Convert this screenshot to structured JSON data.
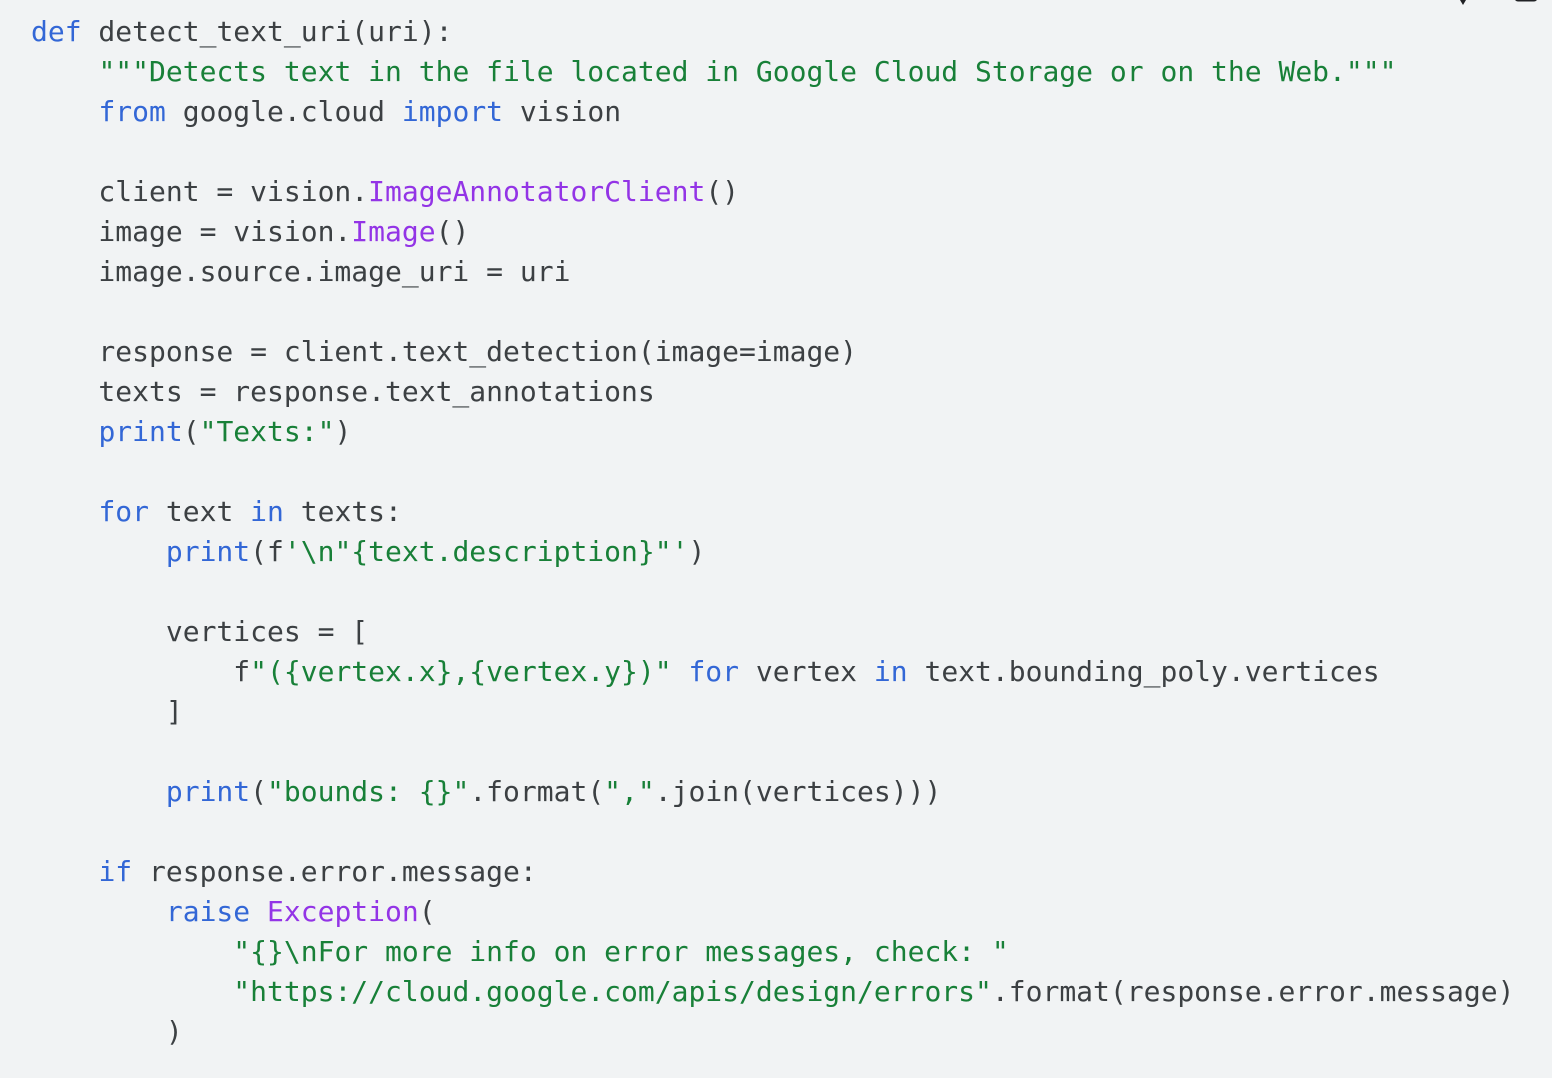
{
  "toolbar": {
    "icons": [
      "feedback-icon",
      "copy-icon"
    ]
  },
  "code": {
    "language": "python",
    "lines": [
      [
        {
          "t": "keyword",
          "v": "def"
        },
        {
          "t": "plain",
          "v": " detect_text_uri(uri):"
        }
      ],
      [
        {
          "t": "plain",
          "v": "    "
        },
        {
          "t": "string",
          "v": "\"\"\"Detects text in the file located in Google Cloud Storage or on the Web.\"\"\""
        }
      ],
      [
        {
          "t": "plain",
          "v": "    "
        },
        {
          "t": "keyword",
          "v": "from"
        },
        {
          "t": "plain",
          "v": " google.cloud "
        },
        {
          "t": "keyword",
          "v": "import"
        },
        {
          "t": "plain",
          "v": " vision"
        }
      ],
      [
        {
          "t": "plain",
          "v": ""
        }
      ],
      [
        {
          "t": "plain",
          "v": "    client = vision."
        },
        {
          "t": "class",
          "v": "ImageAnnotatorClient"
        },
        {
          "t": "plain",
          "v": "()"
        }
      ],
      [
        {
          "t": "plain",
          "v": "    image = vision."
        },
        {
          "t": "class",
          "v": "Image"
        },
        {
          "t": "plain",
          "v": "()"
        }
      ],
      [
        {
          "t": "plain",
          "v": "    image.source.image_uri = uri"
        }
      ],
      [
        {
          "t": "plain",
          "v": ""
        }
      ],
      [
        {
          "t": "plain",
          "v": "    response = client.text_detection(image=image)"
        }
      ],
      [
        {
          "t": "plain",
          "v": "    texts = response.text_annotations"
        }
      ],
      [
        {
          "t": "plain",
          "v": "    "
        },
        {
          "t": "builtin",
          "v": "print"
        },
        {
          "t": "plain",
          "v": "("
        },
        {
          "t": "string",
          "v": "\"Texts:\""
        },
        {
          "t": "plain",
          "v": ")"
        }
      ],
      [
        {
          "t": "plain",
          "v": ""
        }
      ],
      [
        {
          "t": "plain",
          "v": "    "
        },
        {
          "t": "keyword",
          "v": "for"
        },
        {
          "t": "plain",
          "v": " text "
        },
        {
          "t": "keyword",
          "v": "in"
        },
        {
          "t": "plain",
          "v": " texts:"
        }
      ],
      [
        {
          "t": "plain",
          "v": "        "
        },
        {
          "t": "builtin",
          "v": "print"
        },
        {
          "t": "plain",
          "v": "(f"
        },
        {
          "t": "string",
          "v": "'\\n\"{text.description}\"'"
        },
        {
          "t": "plain",
          "v": ")"
        }
      ],
      [
        {
          "t": "plain",
          "v": ""
        }
      ],
      [
        {
          "t": "plain",
          "v": "        vertices = ["
        }
      ],
      [
        {
          "t": "plain",
          "v": "            f"
        },
        {
          "t": "string",
          "v": "\"({vertex.x},{vertex.y})\""
        },
        {
          "t": "plain",
          "v": " "
        },
        {
          "t": "keyword",
          "v": "for"
        },
        {
          "t": "plain",
          "v": " vertex "
        },
        {
          "t": "keyword",
          "v": "in"
        },
        {
          "t": "plain",
          "v": " text.bounding_poly.vertices"
        }
      ],
      [
        {
          "t": "plain",
          "v": "        ]"
        }
      ],
      [
        {
          "t": "plain",
          "v": ""
        }
      ],
      [
        {
          "t": "plain",
          "v": "        "
        },
        {
          "t": "builtin",
          "v": "print"
        },
        {
          "t": "plain",
          "v": "("
        },
        {
          "t": "string",
          "v": "\"bounds: {}\""
        },
        {
          "t": "plain",
          "v": ".format("
        },
        {
          "t": "string",
          "v": "\",\""
        },
        {
          "t": "plain",
          "v": ".join(vertices)))"
        }
      ],
      [
        {
          "t": "plain",
          "v": ""
        }
      ],
      [
        {
          "t": "plain",
          "v": "    "
        },
        {
          "t": "keyword",
          "v": "if"
        },
        {
          "t": "plain",
          "v": " response.error.message:"
        }
      ],
      [
        {
          "t": "plain",
          "v": "        "
        },
        {
          "t": "keyword",
          "v": "raise"
        },
        {
          "t": "plain",
          "v": " "
        },
        {
          "t": "class",
          "v": "Exception"
        },
        {
          "t": "plain",
          "v": "("
        }
      ],
      [
        {
          "t": "plain",
          "v": "            "
        },
        {
          "t": "string",
          "v": "\"{}\\nFor more info on error messages, check: \""
        }
      ],
      [
        {
          "t": "plain",
          "v": "            "
        },
        {
          "t": "string",
          "v": "\"https://cloud.google.com/apis/design/errors\""
        },
        {
          "t": "plain",
          "v": ".format(response.error.message)"
        }
      ],
      [
        {
          "t": "plain",
          "v": "        )"
        }
      ]
    ]
  }
}
